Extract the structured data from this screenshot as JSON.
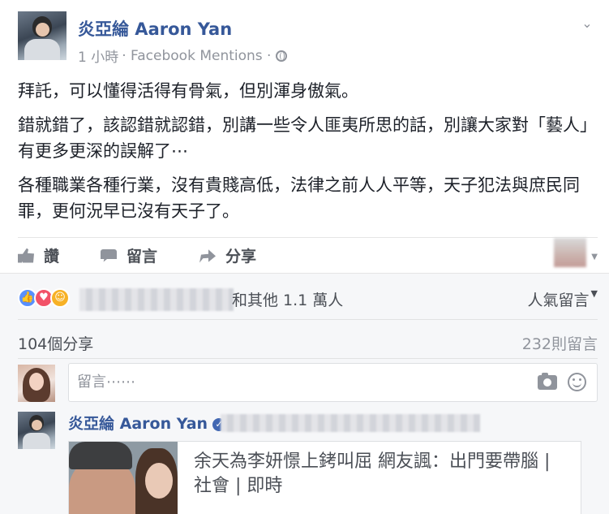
{
  "post": {
    "author": "炎亞綸 Aaron Yan",
    "time": "1 小時",
    "source": "· Facebook Mentions ·",
    "menu_icon": "chevron-down-icon",
    "paragraphs": [
      "拜託，可以懂得活得有骨氣，但別渾身傲氣。",
      "錯就錯了，該認錯就認錯，別講一些令人匪夷所思的話，別讓大家對「藝人」有更多更深的誤解了⋯",
      "各種職業各種行業，沒有貴賤高低，法律之前人人平等，天子犯法與庶民同罪，更何況早已沒有天子了。"
    ]
  },
  "actions": {
    "like_label": "讚",
    "comment_label": "留言",
    "share_label": "分享"
  },
  "feedback": {
    "reaction_icons": [
      "like-reaction-icon",
      "love-reaction-icon",
      "haha-reaction-icon"
    ],
    "reaction_summary": "和其他 1.1 萬人",
    "top_comments_label": "人氣留言",
    "share_count": "104個分享",
    "comment_count": "232則留言"
  },
  "composer": {
    "placeholder": "留言⋯⋯"
  },
  "comment": {
    "author": "炎亞綸 Aaron Yan",
    "link_title": "余天為李妍憬上銬叫屈 網友諷：出門要帶腦 | 社會 | 即時"
  },
  "colors": {
    "link_blue": "#365899",
    "text": "#1d2129",
    "muted": "#90949c",
    "feedback_bg": "#f6f7f9"
  }
}
